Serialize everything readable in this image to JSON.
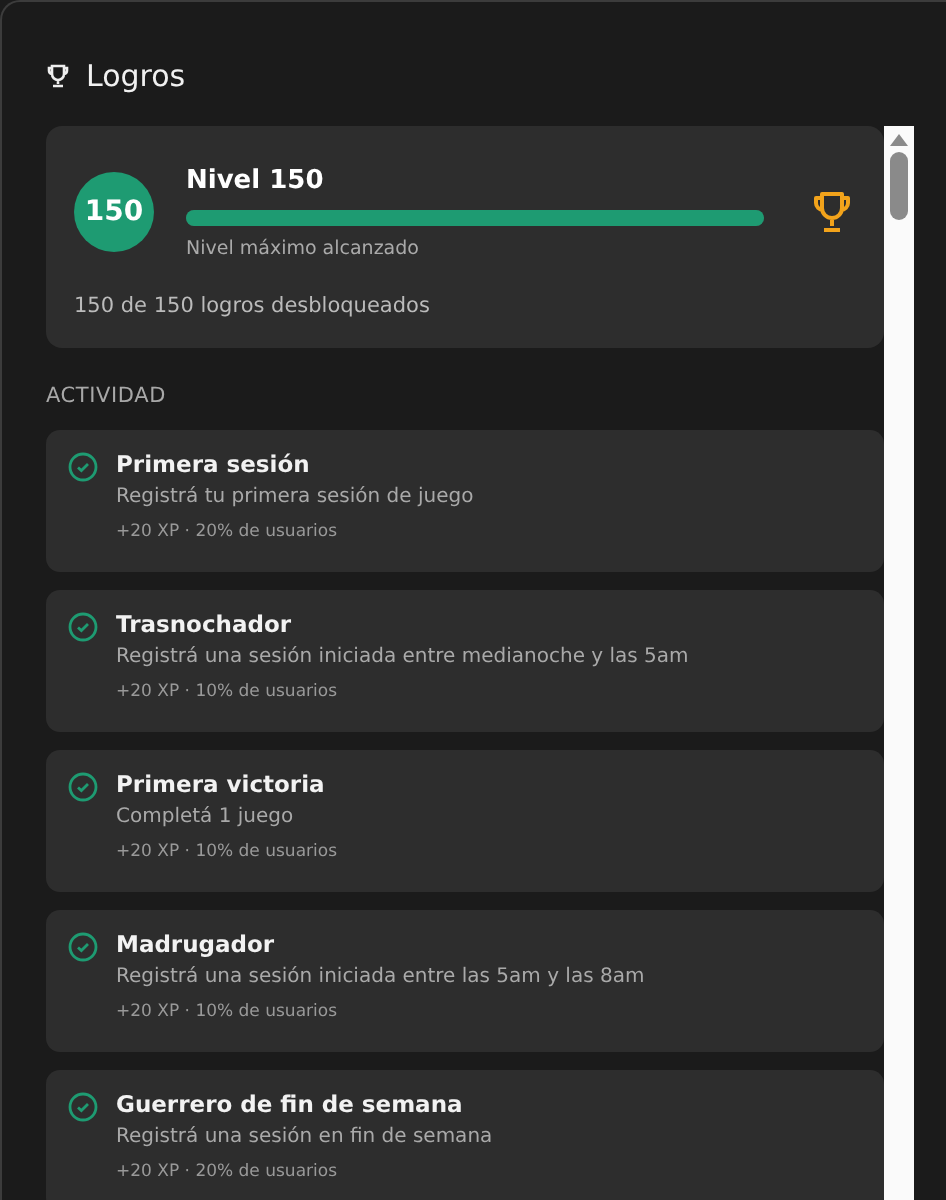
{
  "panel": {
    "title": "Logros"
  },
  "level_card": {
    "badge": "150",
    "title": "Nivel 150",
    "level": 1.0,
    "caption": "Nivel máximo alcanzado",
    "summary": "150 de 150 logros desbloqueados"
  },
  "section": "ACTIVIDAD",
  "achievements": [
    {
      "title": "Primera sesión",
      "description": "Registrá tu primera sesión de juego",
      "meta": "+20 XP · 20% de usuarios",
      "unlocked": true
    },
    {
      "title": "Trasnochador",
      "description": "Registrá una sesión iniciada entre medianoche y las 5am",
      "meta": "+20 XP · 10% de usuarios",
      "unlocked": true
    },
    {
      "title": "Primera victoria",
      "description": "Completá 1 juego",
      "meta": "+20 XP · 10% de usuarios",
      "unlocked": true
    },
    {
      "title": "Madrugador",
      "description": "Registrá una sesión iniciada entre las 5am y las 8am",
      "meta": "+20 XP · 10% de usuarios",
      "unlocked": true
    },
    {
      "title": "Guerrero de fin de semana",
      "description": "Registrá una sesión en fin de semana",
      "meta": "+20 XP · 20% de usuarios",
      "unlocked": true
    }
  ]
}
